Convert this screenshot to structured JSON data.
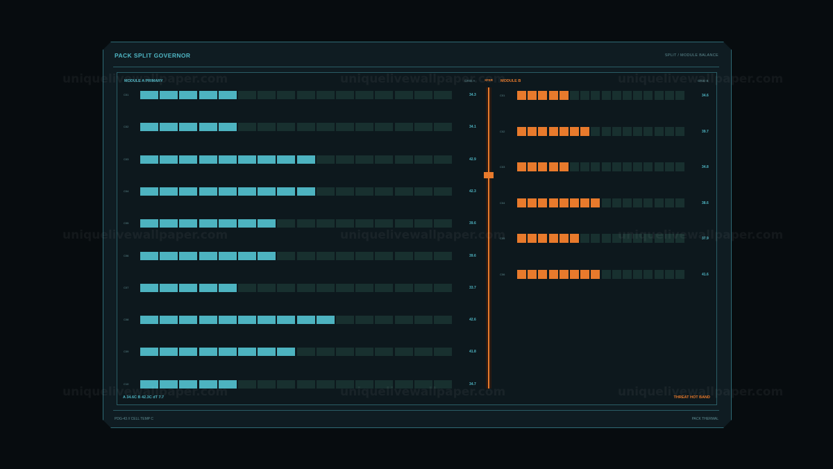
{
  "header": {
    "title": "PACK SPLIT GOVERNOR",
    "breadcrumb": "SPLIT  /  MODULE BALANCE"
  },
  "module_a": {
    "label": "MODULE A  PRIMARY",
    "grid_label": "GRID A",
    "segments": 16,
    "cells": [
      {
        "id": "C01",
        "value": "34.3",
        "fill": 5
      },
      {
        "id": "C02",
        "value": "34.1",
        "fill": 5
      },
      {
        "id": "C03",
        "value": "42.9",
        "fill": 9
      },
      {
        "id": "C04",
        "value": "42.3",
        "fill": 9
      },
      {
        "id": "C05",
        "value": "39.6",
        "fill": 7
      },
      {
        "id": "C06",
        "value": "39.6",
        "fill": 7
      },
      {
        "id": "C07",
        "value": "33.7",
        "fill": 5
      },
      {
        "id": "C08",
        "value": "42.6",
        "fill": 10
      },
      {
        "id": "C09",
        "value": "41.8",
        "fill": 8
      },
      {
        "id": "C10",
        "value": "34.7",
        "fill": 5
      }
    ]
  },
  "module_b": {
    "label": "MODULE B",
    "grid_label": "GRID B",
    "segments": 16,
    "cells": [
      {
        "id": "C01",
        "value": "34.6",
        "fill": 5
      },
      {
        "id": "C02",
        "value": "39.7",
        "fill": 7
      },
      {
        "id": "C03",
        "value": "34.8",
        "fill": 5
      },
      {
        "id": "C04",
        "value": "38.6",
        "fill": 8
      },
      {
        "id": "C05",
        "value": "37.9",
        "fill": 6
      },
      {
        "id": "C06",
        "value": "41.6",
        "fill": 8
      }
    ]
  },
  "transfer": {
    "label": "XFER",
    "position": 0.29
  },
  "footer": {
    "summary": "A 34.6C   B 42.3C   dT 7.7",
    "threat": "THREAT  HOT BAND"
  },
  "bottom": {
    "left": "PDG-43  //  CELL TEMP  C",
    "right": "PACK THERMAL"
  },
  "watermark": "uniquelivewallpaper.com",
  "colors": {
    "a_fill": "#4db3c0",
    "b_fill": "#e87a2c",
    "empty": "#18302f"
  }
}
